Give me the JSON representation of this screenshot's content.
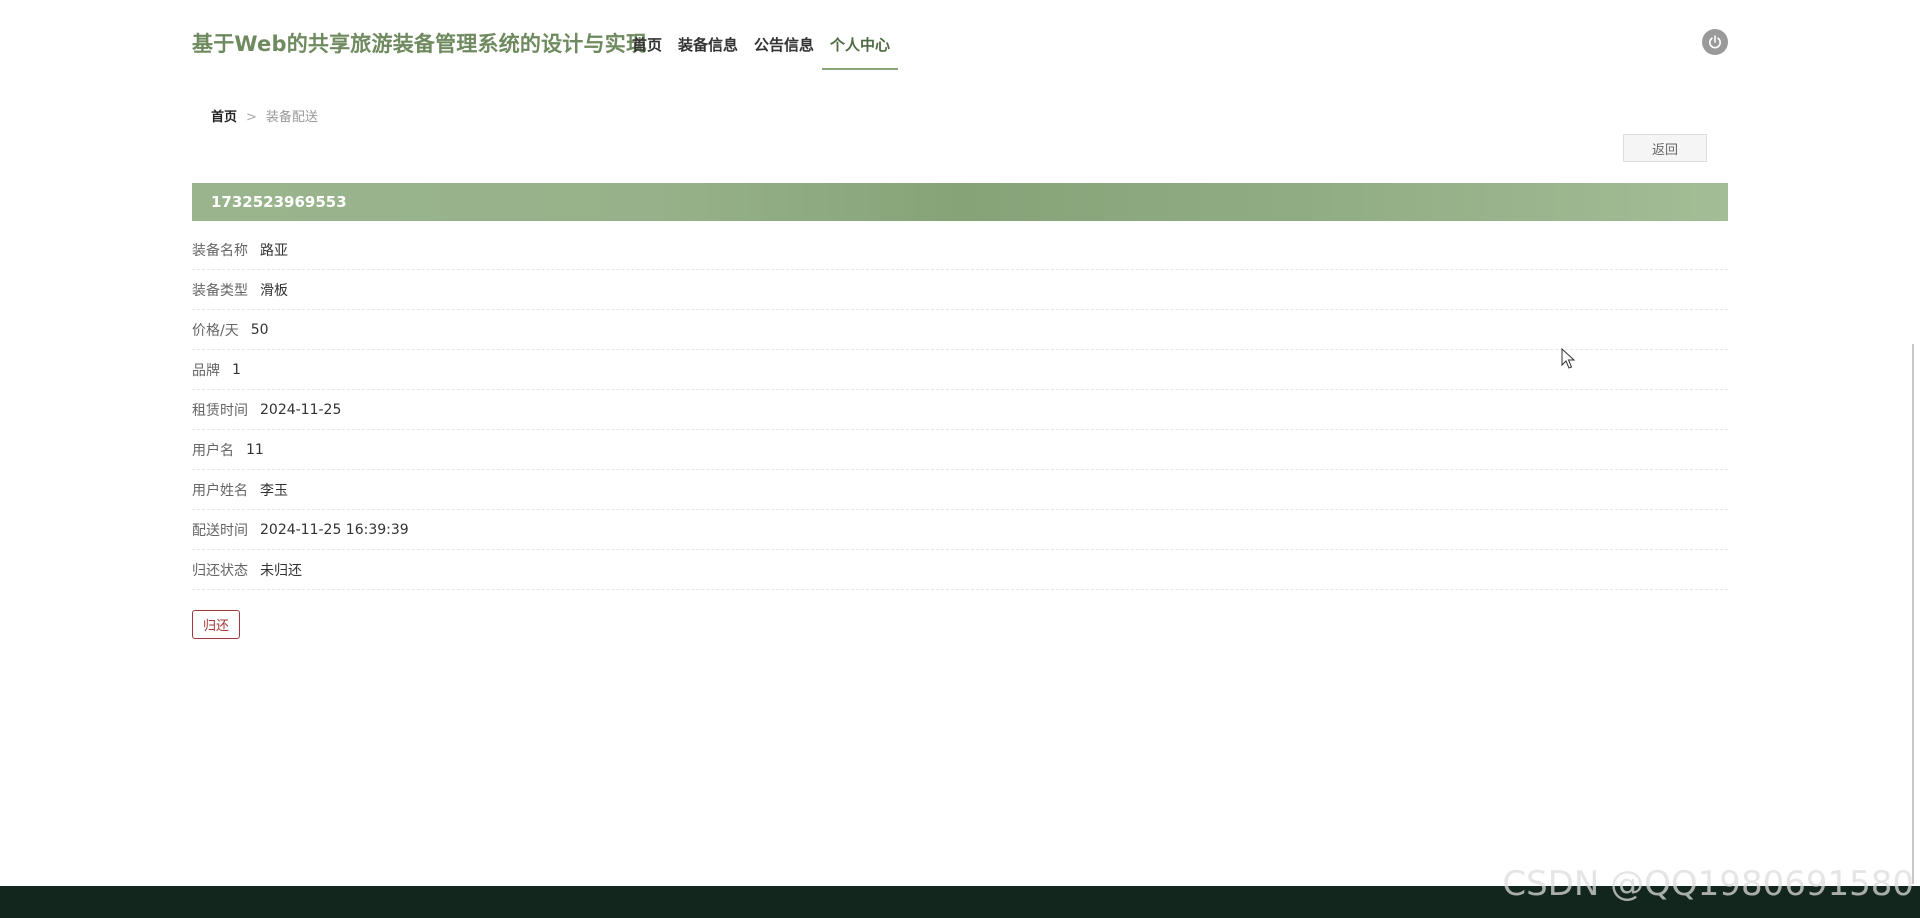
{
  "header": {
    "site_title": "基于Web的共享旅游装备管理系统的设计与实现",
    "nav": [
      {
        "label": "首页",
        "active": false
      },
      {
        "label": "装备信息",
        "active": false
      },
      {
        "label": "公告信息",
        "active": false
      },
      {
        "label": "个人中心",
        "active": true
      }
    ],
    "logout_icon": "power-icon"
  },
  "breadcrumb": {
    "home": "首页",
    "separator": ">",
    "current": "装备配送"
  },
  "actions": {
    "back_label": "返回",
    "return_label": "归还"
  },
  "record": {
    "id": "1732523969553",
    "fields": [
      {
        "label": "装备名称",
        "value": "路亚"
      },
      {
        "label": "装备类型",
        "value": "滑板"
      },
      {
        "label": "价格/天",
        "value": "50"
      },
      {
        "label": "品牌",
        "value": "1"
      },
      {
        "label": "租赁时间",
        "value": "2024-11-25"
      },
      {
        "label": "用户名",
        "value": "11"
      },
      {
        "label": "用户姓名",
        "value": "李玉"
      },
      {
        "label": "配送时间",
        "value": "2024-11-25 16:39:39"
      },
      {
        "label": "归还状态",
        "value": "未归还"
      }
    ]
  },
  "watermark": "CSDN @QQ1980691580",
  "colors": {
    "brand_green": "#6f8a5f",
    "bar_green": "#8faa82",
    "return_red": "#a33a3a",
    "footer_dark": "#13261d"
  }
}
